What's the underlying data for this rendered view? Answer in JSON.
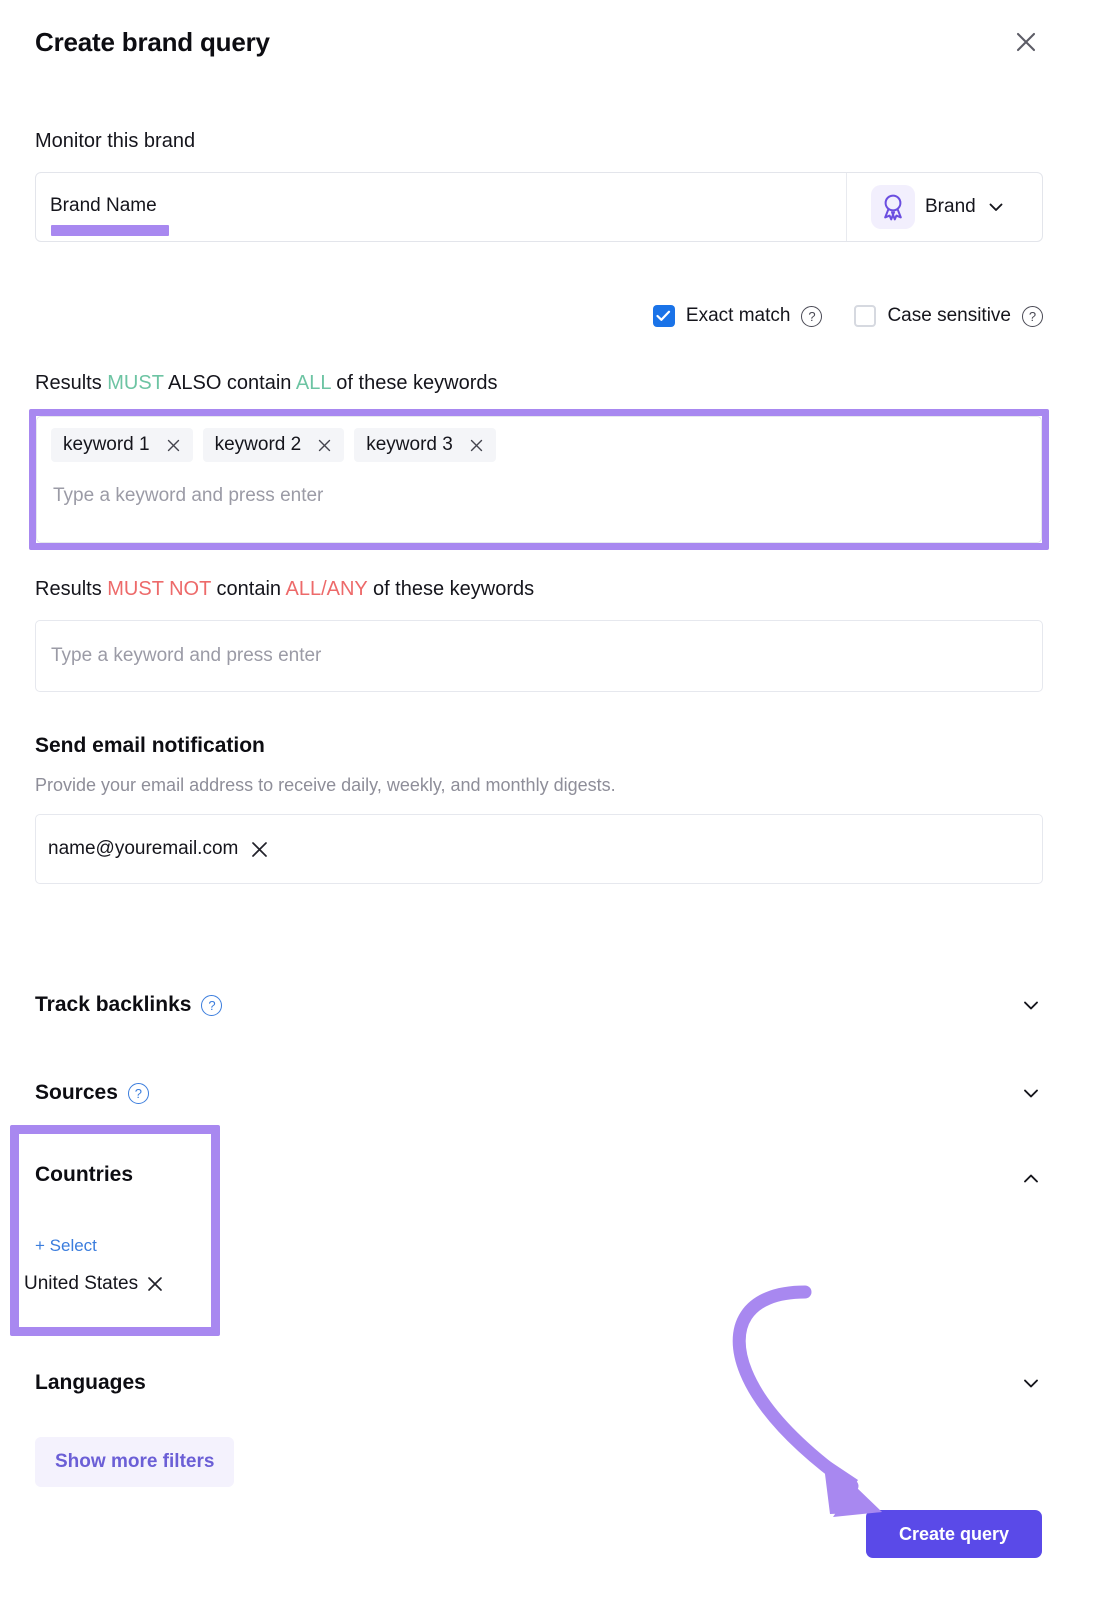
{
  "modal": {
    "title": "Create brand query",
    "close_icon": "close-icon"
  },
  "brand": {
    "section_label": "Monitor this brand",
    "input_value": "Brand Name",
    "input_placeholder": "Brand Name",
    "type_label": "Brand",
    "type_icon": "award-badge-icon",
    "chevron_icon": "chevron-down-icon",
    "highlight_color": "#a888f0"
  },
  "options": {
    "exact_match_label": "Exact match",
    "exact_match_checked": true,
    "case_sensitive_label": "Case sensitive",
    "case_sensitive_checked": false,
    "help_icon": "question-mark-icon",
    "checked_color": "#1a73e8"
  },
  "must_contain": {
    "label_prefix": "Results ",
    "label_must": "MUST",
    "label_mid": " ALSO contain ",
    "label_all": "ALL",
    "label_suffix": " of these keywords",
    "accent_color": "#6dc4a3",
    "chips": [
      "keyword 1",
      "keyword 2",
      "keyword 3"
    ],
    "placeholder": "Type a keyword and press enter",
    "highlighted": true
  },
  "must_not_contain": {
    "label_prefix": "Results ",
    "label_must_not": "MUST NOT",
    "label_mid": " contain ",
    "label_all_any": "ALL/ANY",
    "label_suffix": " of these keywords",
    "accent_color": "#ed6a6a",
    "placeholder": "Type a keyword and press enter"
  },
  "email": {
    "title": "Send email notification",
    "description": "Provide your email address to receive daily, weekly, and monthly digests.",
    "value": "name@youremail.com",
    "remove_icon": "close-icon"
  },
  "accordions": [
    {
      "title": "Track backlinks",
      "has_help": true,
      "expanded": false,
      "chevron": "chevron-down-icon"
    },
    {
      "title": "Sources",
      "has_help": true,
      "expanded": false,
      "chevron": "chevron-down-icon"
    },
    {
      "title": "Countries",
      "has_help": false,
      "expanded": true,
      "chevron": "chevron-up-icon"
    },
    {
      "title": "Languages",
      "has_help": false,
      "expanded": false,
      "chevron": "chevron-down-icon"
    }
  ],
  "countries": {
    "title": "Countries",
    "select_label": "+ Select",
    "selected": "United States",
    "remove_icon": "close-icon",
    "highlighted": true
  },
  "footer": {
    "show_more_label": "Show more filters",
    "create_label": "Create query",
    "create_color": "#5a4ae8",
    "annotation_arrow": "curved-arrow-pointing-to-create-query"
  }
}
